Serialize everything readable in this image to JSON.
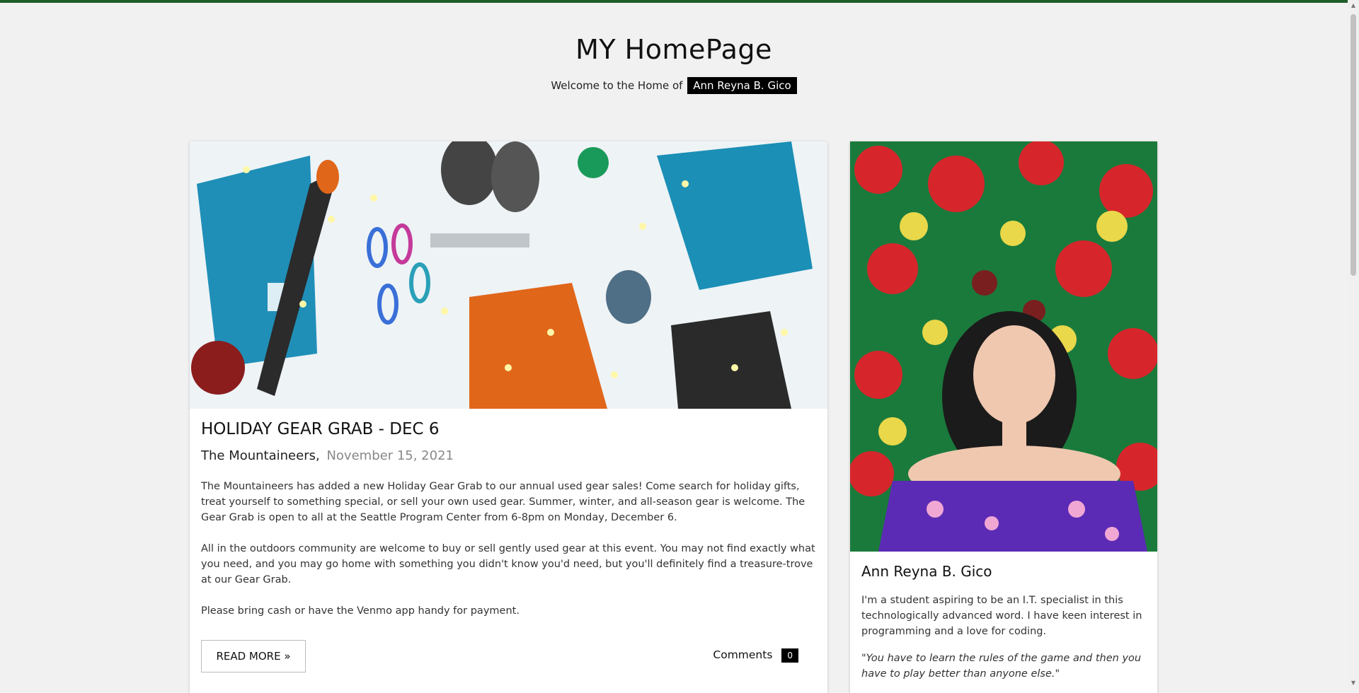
{
  "header": {
    "title": "MY HomePage",
    "welcome_text": "Welcome to the Home of",
    "owner_name": "Ann Reyna B. Gico"
  },
  "post": {
    "title": "HOLIDAY GEAR GRAB - DEC 6",
    "author": "The Mountaineers,",
    "date": "November 15, 2021",
    "paragraphs": [
      "The Mountaineers has added a new Holiday Gear Grab to our annual used gear sales! Come search for holiday gifts, treat yourself to something special, or sell your own used gear. Summer, winter, and all-season gear is welcome. The Gear Grab is open to all at the Seattle Program Center from 6-8pm on Monday, December 6.",
      "All in the outdoors community are welcome to buy or sell gently used gear at this event. You may not find exactly what you need, and you may go home with something you didn't know you'd need, but you'll definitely find a treasure-trove at our Gear Grab.",
      "Please bring cash or have the Venmo app handy for payment."
    ],
    "read_more_label": "READ MORE »",
    "comments_label": "Comments",
    "comments_count": "0"
  },
  "profile": {
    "name": "Ann Reyna B. Gico",
    "bio": "I'm a student aspiring to be an I.T. specialist in this technologically advanced word. I have keen interest in programming and a love for coding.",
    "quote": "\"You have to learn the rules of the game and then you have to play better than anyone else.\""
  },
  "colors": {
    "accent_bar": "#1f5e2a",
    "badge_bg": "#000000",
    "page_bg": "#f1f1f1"
  },
  "icons": {
    "scroll_up": "arrow-up-icon",
    "scroll_down": "arrow-down-icon"
  }
}
